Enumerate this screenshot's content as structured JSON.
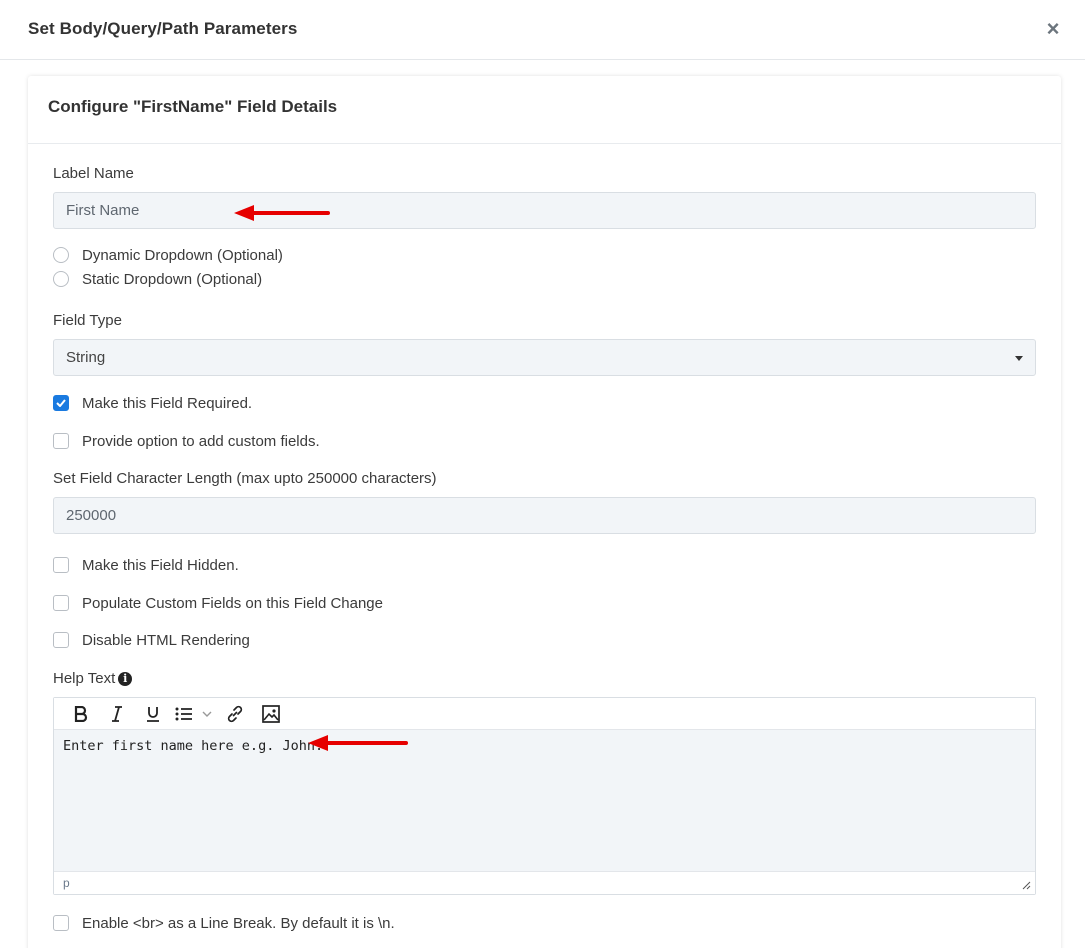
{
  "modal": {
    "title": "Set Body/Query/Path Parameters",
    "close_label": "×"
  },
  "card": {
    "title": "Configure \"FirstName\" Field Details"
  },
  "label_name": {
    "label": "Label Name",
    "value": "First Name"
  },
  "radios": [
    {
      "label": "Dynamic Dropdown (Optional)",
      "selected": false
    },
    {
      "label": "Static Dropdown (Optional)",
      "selected": false
    }
  ],
  "field_type": {
    "label": "Field Type",
    "selected": "String"
  },
  "checkboxes_top": [
    {
      "label": "Make this Field Required.",
      "checked": true
    },
    {
      "label": "Provide option to add custom fields.",
      "checked": false
    }
  ],
  "char_length": {
    "label": "Set Field Character Length (max upto 250000 characters)",
    "value": "250000"
  },
  "checkboxes_mid": [
    {
      "label": "Make this Field Hidden.",
      "checked": false
    },
    {
      "label": "Populate Custom Fields on this Field Change",
      "checked": false
    },
    {
      "label": "Disable HTML Rendering",
      "checked": false
    }
  ],
  "help_text": {
    "label": "Help Text",
    "content": "Enter first name here e.g. John.",
    "status_path": "p",
    "toolbar": [
      "bold-icon",
      "italic-icon",
      "underline-icon",
      "bullet-list-icon",
      "link-icon",
      "image-icon"
    ]
  },
  "checkbox_bottom": {
    "label": "Enable <br> as a Line Break. By default it is \\n.",
    "checked": false
  },
  "colors": {
    "accent": "#1a7ae0",
    "arrow": "#e60000",
    "input_bg": "#f2f5f8"
  }
}
